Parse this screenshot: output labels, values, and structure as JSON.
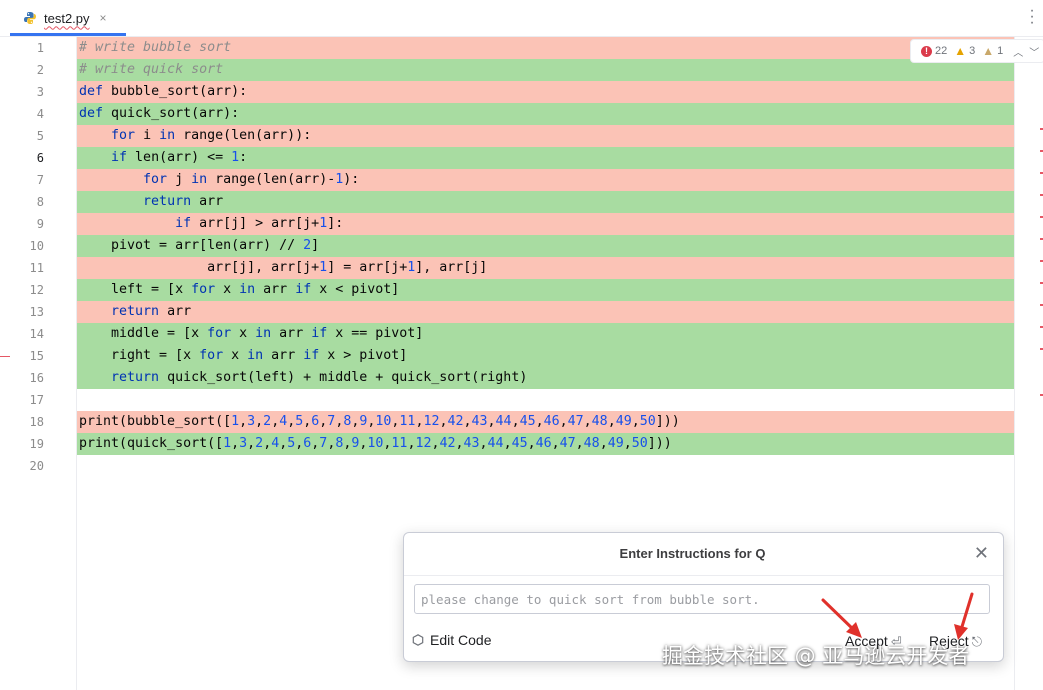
{
  "tab": {
    "filename": "test2.py",
    "close_glyph": "×"
  },
  "inspections": {
    "errors": "22",
    "warnings": "3",
    "weak_warnings": "1"
  },
  "editor": {
    "lines": [
      {
        "n": "1",
        "type": "del",
        "text": "# write bubble sort"
      },
      {
        "n": "2",
        "type": "add",
        "text": "# write quick sort"
      },
      {
        "n": "3",
        "type": "del",
        "text": "def bubble_sort(arr):"
      },
      {
        "n": "4",
        "type": "add",
        "text": "def quick_sort(arr):"
      },
      {
        "n": "5",
        "type": "del",
        "text": "    for i in range(len(arr)):"
      },
      {
        "n": "6",
        "type": "add",
        "text": "    if len(arr) <= 1:"
      },
      {
        "n": "7",
        "type": "del",
        "text": "        for j in range(len(arr)-1):"
      },
      {
        "n": "8",
        "type": "add",
        "text": "        return arr"
      },
      {
        "n": "9",
        "type": "del",
        "text": "            if arr[j] > arr[j+1]:"
      },
      {
        "n": "10",
        "type": "add",
        "text": "    pivot = arr[len(arr) // 2]"
      },
      {
        "n": "11",
        "type": "del",
        "text": "                arr[j], arr[j+1] = arr[j+1], arr[j]"
      },
      {
        "n": "12",
        "type": "add",
        "text": "    left = [x for x in arr if x < pivot]"
      },
      {
        "n": "13",
        "type": "del",
        "text": "    return arr"
      },
      {
        "n": "14",
        "type": "add",
        "text": "    middle = [x for x in arr if x == pivot]"
      },
      {
        "n": "15",
        "type": "add",
        "text": "    right = [x for x in arr if x > pivot]"
      },
      {
        "n": "16",
        "type": "add",
        "text": "    return quick_sort(left) + middle + quick_sort(right)"
      },
      {
        "n": "17",
        "type": "none",
        "text": ""
      },
      {
        "n": "18",
        "type": "del",
        "text": "print(bubble_sort([1,3,2,4,5,6,7,8,9,10,11,12,42,43,44,45,46,47,48,49,50]))"
      },
      {
        "n": "19",
        "type": "add",
        "text": "print(quick_sort([1,3,2,4,5,6,7,8,9,10,11,12,42,43,44,45,46,47,48,49,50]))"
      },
      {
        "n": "20",
        "type": "none",
        "text": ""
      }
    ]
  },
  "dialog": {
    "title": "Enter Instructions for Q",
    "close_glyph": "✕",
    "input_placeholder": "please change to quick sort from bubble sort.",
    "edit_code_label": "Edit Code",
    "accept_label": "Accept",
    "accept_key": "⏎",
    "reject_label": "Reject",
    "reject_key": "⎋"
  },
  "watermark": "掘金技术社区 @ 亚马逊云开发者",
  "colors": {
    "deleted_bg": "#fbc3b6",
    "added_bg": "#a8dca1",
    "keyword": "#0033b3",
    "number": "#1750eb",
    "annotation_arrow": "#e0312b"
  }
}
